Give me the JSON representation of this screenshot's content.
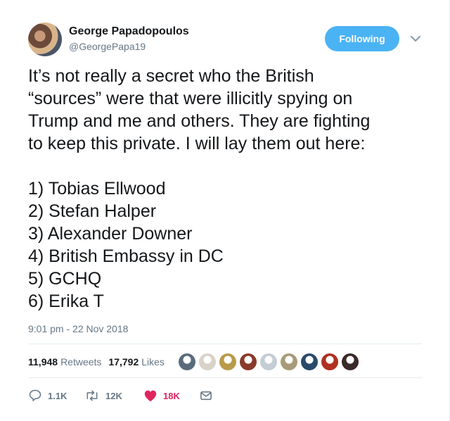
{
  "author": {
    "name": "George Papadopoulos",
    "handle": "@GeorgePapa19"
  },
  "follow_button": {
    "label": "Following"
  },
  "tweet": {
    "intro_lines": [
      "It’s not really a secret who the British",
      "“sources” were that were illicitly spying on",
      "Trump and me and others. They are fighting",
      "to keep this private. I will lay them out here:"
    ],
    "list": [
      "1) Tobias Ellwood",
      "2) Stefan Halper",
      "3) Alexander Downer",
      "4) British Embassy in DC",
      "5) GCHQ",
      "6) Erika T"
    ],
    "timestamp": "9:01 pm - 22 Nov 2018"
  },
  "stats": {
    "retweets_count": "11,948",
    "retweets_label": "Retweets",
    "likes_count": "17,792",
    "likes_label": "Likes"
  },
  "likers": [
    {
      "color": "#5a6b7c",
      "icon": "avatar"
    },
    {
      "color": "#d8d2c8",
      "icon": "avatar"
    },
    {
      "color": "#b89a4a",
      "icon": "avatar"
    },
    {
      "color": "#8a3a2a",
      "icon": "avatar"
    },
    {
      "color": "#c4ccd4",
      "icon": "default-avatar"
    },
    {
      "color": "#a89a7a",
      "icon": "avatar"
    },
    {
      "color": "#2a4a6a",
      "icon": "avatar"
    },
    {
      "color": "#b03020",
      "icon": "avatar"
    },
    {
      "color": "#3a2a2a",
      "icon": "avatar"
    }
  ],
  "actions": {
    "reply_count": "1.1K",
    "retweet_count": "12K",
    "like_count": "18K"
  },
  "colors": {
    "accent": "#4ab3f4",
    "like": "#e0245e",
    "muted": "#657786",
    "divider": "#e6ecf0"
  }
}
